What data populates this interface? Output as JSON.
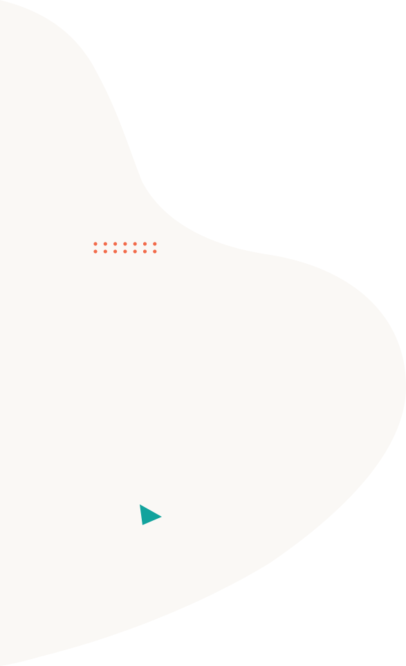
{
  "colors": {
    "background": "#ffffff",
    "blob": "#faf8f5",
    "dots": "#f26b4a",
    "triangle": "#12a39d"
  },
  "decorations": {
    "dots": {
      "rows": 2,
      "columns": 7,
      "icon": "dot-grid"
    },
    "triangle": {
      "icon": "play-triangle"
    }
  }
}
